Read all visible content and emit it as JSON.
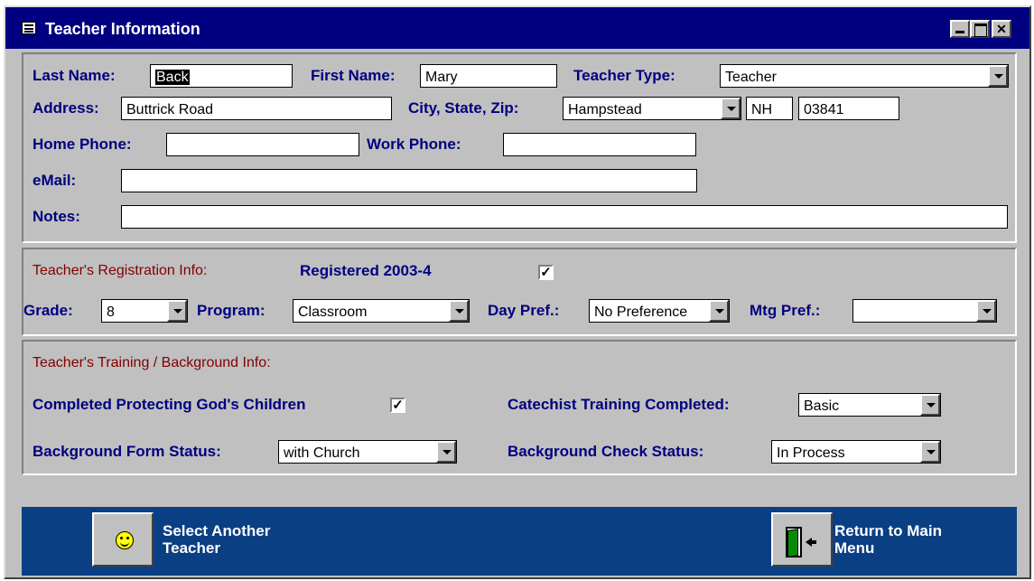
{
  "window": {
    "title": "Teacher Information",
    "icon": "form-icon"
  },
  "personal": {
    "last_name_label": "Last Name:",
    "last_name_value": "Back",
    "first_name_label": "First Name:",
    "first_name_value": "Mary",
    "teacher_type_label": "Teacher Type:",
    "teacher_type_value": "Teacher",
    "address_label": "Address:",
    "address_value": "Buttrick Road",
    "city_state_zip_label": "City, State, Zip:",
    "city_value": "Hampstead",
    "state_value": "NH",
    "zip_value": "03841",
    "home_phone_label": "Home Phone:",
    "home_phone_value": "",
    "work_phone_label": "Work Phone:",
    "work_phone_value": "",
    "email_label": "eMail:",
    "email_value": "",
    "notes_label": "Notes:",
    "notes_value": ""
  },
  "registration": {
    "section_label": "Teacher's Registration Info:",
    "registered_label": "Registered  2003-4",
    "registered_checked": true,
    "check_glyph": "✓",
    "grade_label": "Grade:",
    "grade_value": "8",
    "program_label": "Program:",
    "program_value": "Classroom",
    "day_pref_label": "Day Pref.:",
    "day_pref_value": "No Preference",
    "mtg_pref_label": "Mtg Pref.:",
    "mtg_pref_value": ""
  },
  "training": {
    "section_label": "Teacher's Training / Background Info:",
    "protecting_label": "Completed Protecting God's Children",
    "protecting_checked": true,
    "catechist_label": "Catechist Training Completed:",
    "catechist_value": "Basic",
    "bg_form_label": "Background Form Status:",
    "bg_form_value": "with Church",
    "bg_check_label": "Background Check Status:",
    "bg_check_value": "In Process"
  },
  "footer": {
    "select_line1": "Select Another",
    "select_line2": "Teacher",
    "return_line1": "Return to Main",
    "return_line2": "Menu"
  },
  "colors": {
    "title_bar": "#000080",
    "label_text": "#000080",
    "section_text": "#800000",
    "footer_bg": "#0a3f84",
    "window_bg": "#c0c0c0"
  }
}
